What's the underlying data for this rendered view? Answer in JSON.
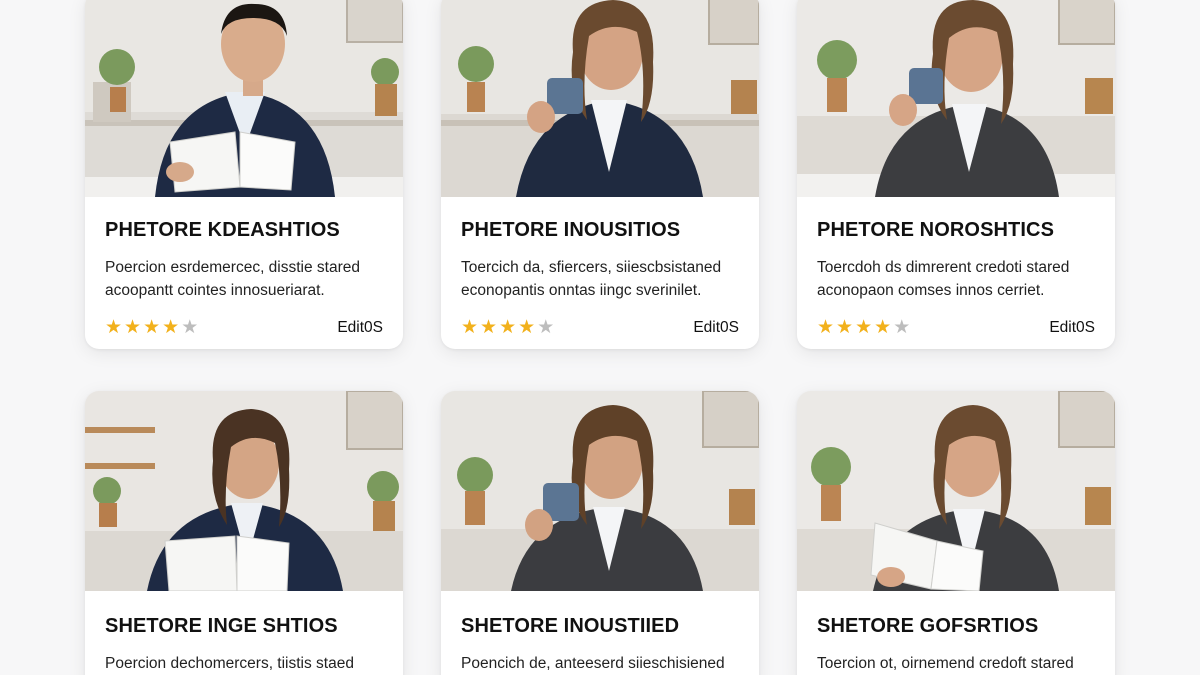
{
  "colors": {
    "star_on": "#f2b11c",
    "star_off": "#bdbdbd",
    "card_bg": "#ffffff",
    "page_bg": "#f7f7f8"
  },
  "cards": [
    {
      "title": "PHETORE KDEASHTIOS",
      "desc_line1": "Poercion esrdemercec, disstie stared",
      "desc_line2": "acoopantt cointes innosueriarat.",
      "rating": 4,
      "edit_label": "Edit0S",
      "photo_icon": "person-reading-photo"
    },
    {
      "title": "PHETORE INOUSITIOS",
      "desc_line1": "Toercich da, sfiercers, siiescbsistaned",
      "desc_line2": "econopantis onntas iingc sverinilet.",
      "rating": 4,
      "edit_label": "Edit0S",
      "photo_icon": "person-with-mug-photo"
    },
    {
      "title": "PHETORE NOROSHTICS",
      "desc_line1": "Toercdoh ds dimrerent credoti stared",
      "desc_line2": "aconopaon comses innos cerriet.",
      "rating": 4,
      "edit_label": "Edit0S",
      "photo_icon": "person-with-mug-photo"
    },
    {
      "title": "SHETORE INGE SHTIOS",
      "desc_line1": "Poercion dechomercers, tiistis staed",
      "desc_line2": "",
      "photo_icon": "person-reading-photo"
    },
    {
      "title": "SHETORE INOUSTIIED",
      "desc_line1": "Poencich de, anteeserd siieschisiened",
      "desc_line2": "",
      "photo_icon": "person-with-mug-photo"
    },
    {
      "title": "SHETORE GOFSRTIOS",
      "desc_line1": "Toercion ot, oirnemend credoft stared",
      "desc_line2": "",
      "photo_icon": "person-reading-photo"
    }
  ]
}
